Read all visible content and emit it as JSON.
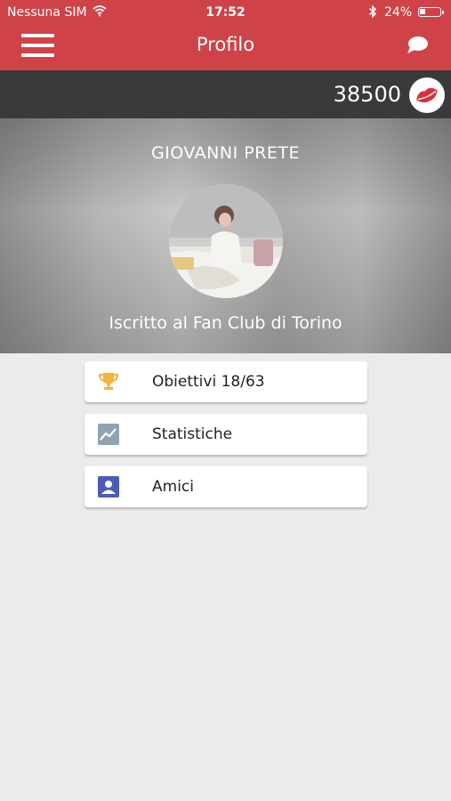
{
  "status_bar": {
    "carrier": "Nessuna SIM",
    "time": "17:52",
    "battery_percent": "24%"
  },
  "nav": {
    "title": "Profilo",
    "menu_icon": "hamburger-menu-icon",
    "chat_icon": "chat-bubble-icon"
  },
  "points": {
    "value": "38500",
    "icon": "kiss-lips-icon"
  },
  "profile": {
    "name": "GIOVANNI PRETE",
    "subscription": "Iscritto al Fan Club di Torino"
  },
  "menu": [
    {
      "label": "Obiettivi 18/63",
      "icon": "trophy-icon"
    },
    {
      "label": "Statistiche",
      "icon": "chart-icon"
    },
    {
      "label": "Amici",
      "icon": "contact-icon"
    }
  ],
  "colors": {
    "brand_red": "#cf4348",
    "points_bar": "#3a3a3a",
    "background": "#ebebeb",
    "trophy": "#f2b43a",
    "chart_icon": "#8ea4b2",
    "contact_icon": "#4a5bb8"
  }
}
